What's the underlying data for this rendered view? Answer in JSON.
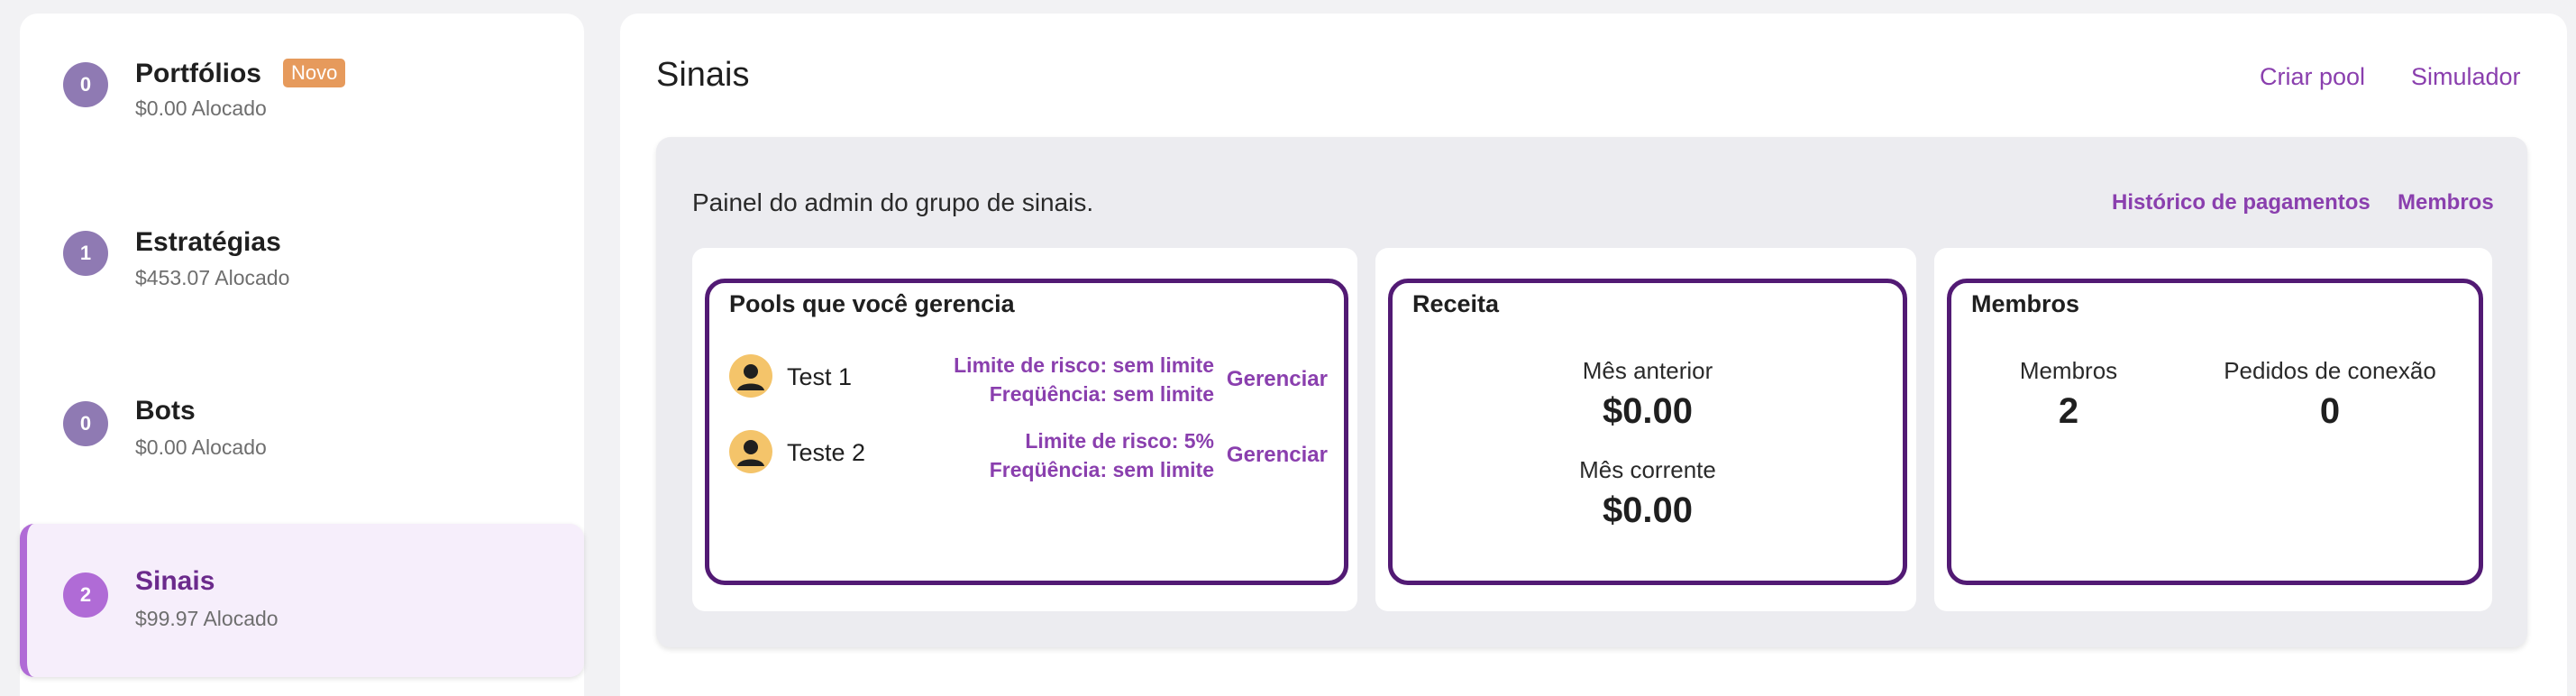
{
  "sidebar": {
    "items": [
      {
        "badge": "0",
        "title": "Portfólios",
        "tag": "Novo",
        "allocated": "$0.00 Alocado"
      },
      {
        "badge": "1",
        "title": "Estratégias",
        "allocated": "$453.07 Alocado"
      },
      {
        "badge": "0",
        "title": "Bots",
        "allocated": "$0.00 Alocado"
      },
      {
        "badge": "2",
        "title": "Sinais",
        "allocated": "$99.97 Alocado",
        "active": true
      }
    ]
  },
  "main": {
    "title": "Sinais",
    "links": {
      "create_pool": "Criar pool",
      "simulator": "Simulador"
    },
    "panel": {
      "description": "Painel do admin do grupo de sinais.",
      "links": {
        "payment_history": "Histórico de pagamentos",
        "members": "Membros"
      },
      "pools_card": {
        "title": "Pools que você gerencia",
        "pools": [
          {
            "name": "Test 1",
            "risk_limit": "Limite de risco: sem limite",
            "frequency": "Freqüência: sem limite",
            "action": "Gerenciar"
          },
          {
            "name": "Teste 2",
            "risk_limit": "Limite de risco: 5%",
            "frequency": "Freqüência: sem limite",
            "action": "Gerenciar"
          }
        ]
      },
      "revenue_card": {
        "title": "Receita",
        "previous_month_label": "Mês anterior",
        "previous_month_value": "$0.00",
        "current_month_label": "Mês corrente",
        "current_month_value": "$0.00"
      },
      "members_card": {
        "title": "Membros",
        "members_label": "Membros",
        "members_value": "2",
        "requests_label": "Pedidos de conexão",
        "requests_value": "0"
      }
    }
  },
  "colors": {
    "accent": "#8a3fae",
    "card_border": "#521a74",
    "badge": "#8f7ab3",
    "badge_active": "#b06bd6",
    "tag": "#e69a5c",
    "avatar": "#f4c46a"
  },
  "icons": {
    "pool_avatar": "user-avatar-icon"
  }
}
